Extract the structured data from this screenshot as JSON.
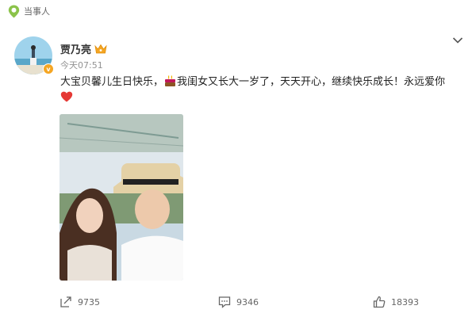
{
  "header": {
    "label": "当事人"
  },
  "post": {
    "username": "贾乃亮",
    "timestamp": "今天07:51",
    "text_part1": "大宝贝馨儿生日快乐，",
    "text_part2": "我闺女又长大一岁了，天天开心，继续快乐成长！永远爱你",
    "avatar_badge": "v",
    "icons": [
      "location-pin-icon",
      "crown-icon",
      "chevron-down-icon",
      "cake-icon",
      "heart-icon",
      "repost-icon",
      "comment-icon",
      "like-icon"
    ]
  },
  "actions": {
    "repost_count": "9735",
    "comment_count": "9346",
    "like_count": "18393"
  },
  "colors": {
    "accent": "#f5a623",
    "pin": "#8bc34a",
    "heart": "#e53935",
    "muted": "#939393"
  }
}
